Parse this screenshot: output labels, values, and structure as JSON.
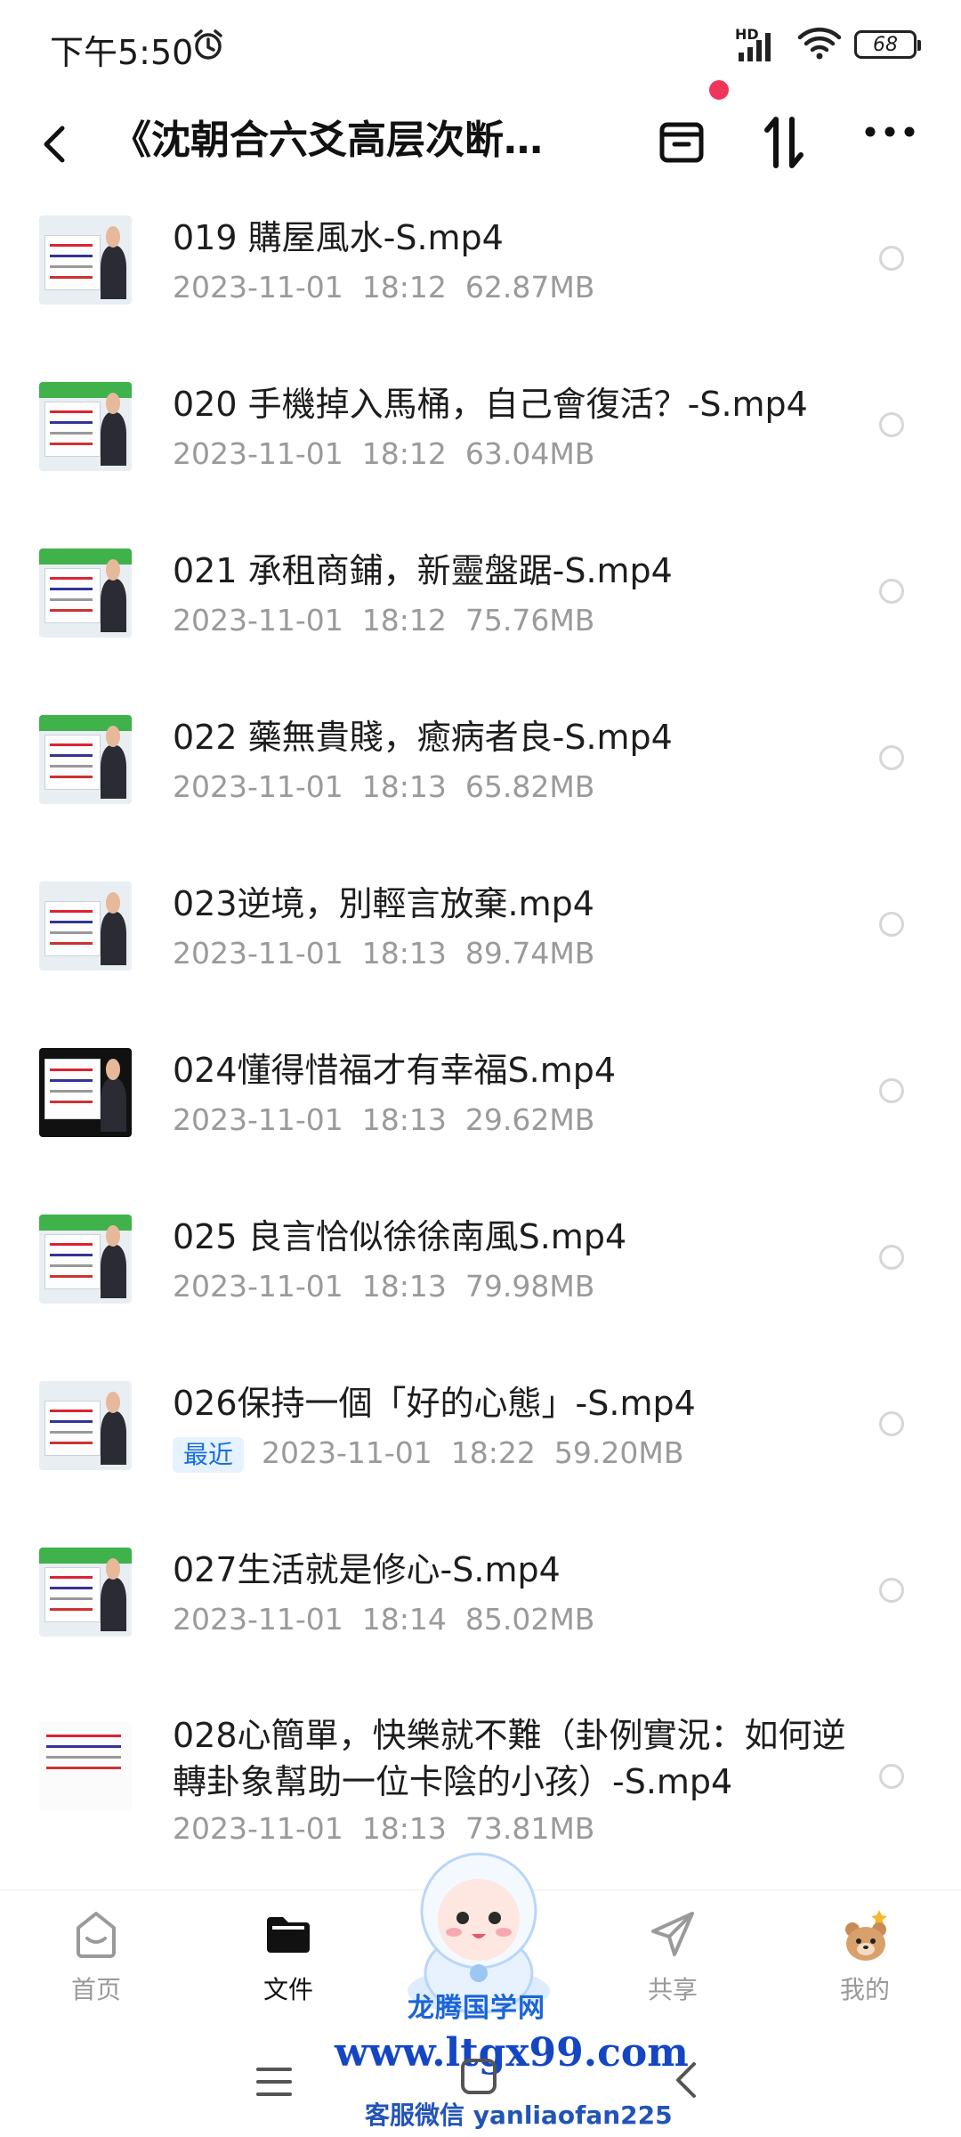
{
  "status_bar": {
    "time": "下午5:50",
    "network_label": "HD",
    "battery": "68"
  },
  "header": {
    "title": "《沈朝合六爻高层次断…"
  },
  "files": [
    {
      "name": "019 購屋風水-S.mp4",
      "date": "2023-11-01",
      "time": "18:12",
      "size": "62.87MB"
    },
    {
      "name": "020 手機掉入馬桶，自己會復活？-S.mp4",
      "date": "2023-11-01",
      "time": "18:12",
      "size": "63.04MB"
    },
    {
      "name": "021 承租商鋪，新靈盤踞-S.mp4",
      "date": "2023-11-01",
      "time": "18:12",
      "size": "75.76MB"
    },
    {
      "name": "022 藥無貴賤，癒病者良-S.mp4",
      "date": "2023-11-01",
      "time": "18:13",
      "size": "65.82MB"
    },
    {
      "name": "023逆境，別輕言放棄.mp4",
      "date": "2023-11-01",
      "time": "18:13",
      "size": "89.74MB"
    },
    {
      "name": "024懂得惜福才有幸福S.mp4",
      "date": "2023-11-01",
      "time": "18:13",
      "size": "29.62MB"
    },
    {
      "name": "025 良言恰似徐徐南風S.mp4",
      "date": "2023-11-01",
      "time": "18:13",
      "size": "79.98MB"
    },
    {
      "name": "026保持一個「好的心態」-S.mp4",
      "badge": "最近",
      "date": "2023-11-01",
      "time": "18:22",
      "size": "59.20MB"
    },
    {
      "name": "027生活就是修心-S.mp4",
      "date": "2023-11-01",
      "time": "18:14",
      "size": "85.02MB"
    },
    {
      "name": "028心簡單，快樂就不難（卦例實況：如何逆轉卦象幫助一位卡陰的小孩）-S.mp4",
      "date": "2023-11-01",
      "time": "18:13",
      "size": "73.81MB"
    }
  ],
  "bottom_nav": {
    "home": "首页",
    "files": "文件",
    "share": "共享",
    "me": "我的"
  },
  "watermark": {
    "name": "龙腾国学网",
    "url": "www.ltgx99.com",
    "wechat": "客服微信 yanliaofan225"
  },
  "colors": {
    "accent_red": "#f0355b",
    "badge_blue": "#1a6fe0",
    "watermark_blue": "#1446c4"
  }
}
